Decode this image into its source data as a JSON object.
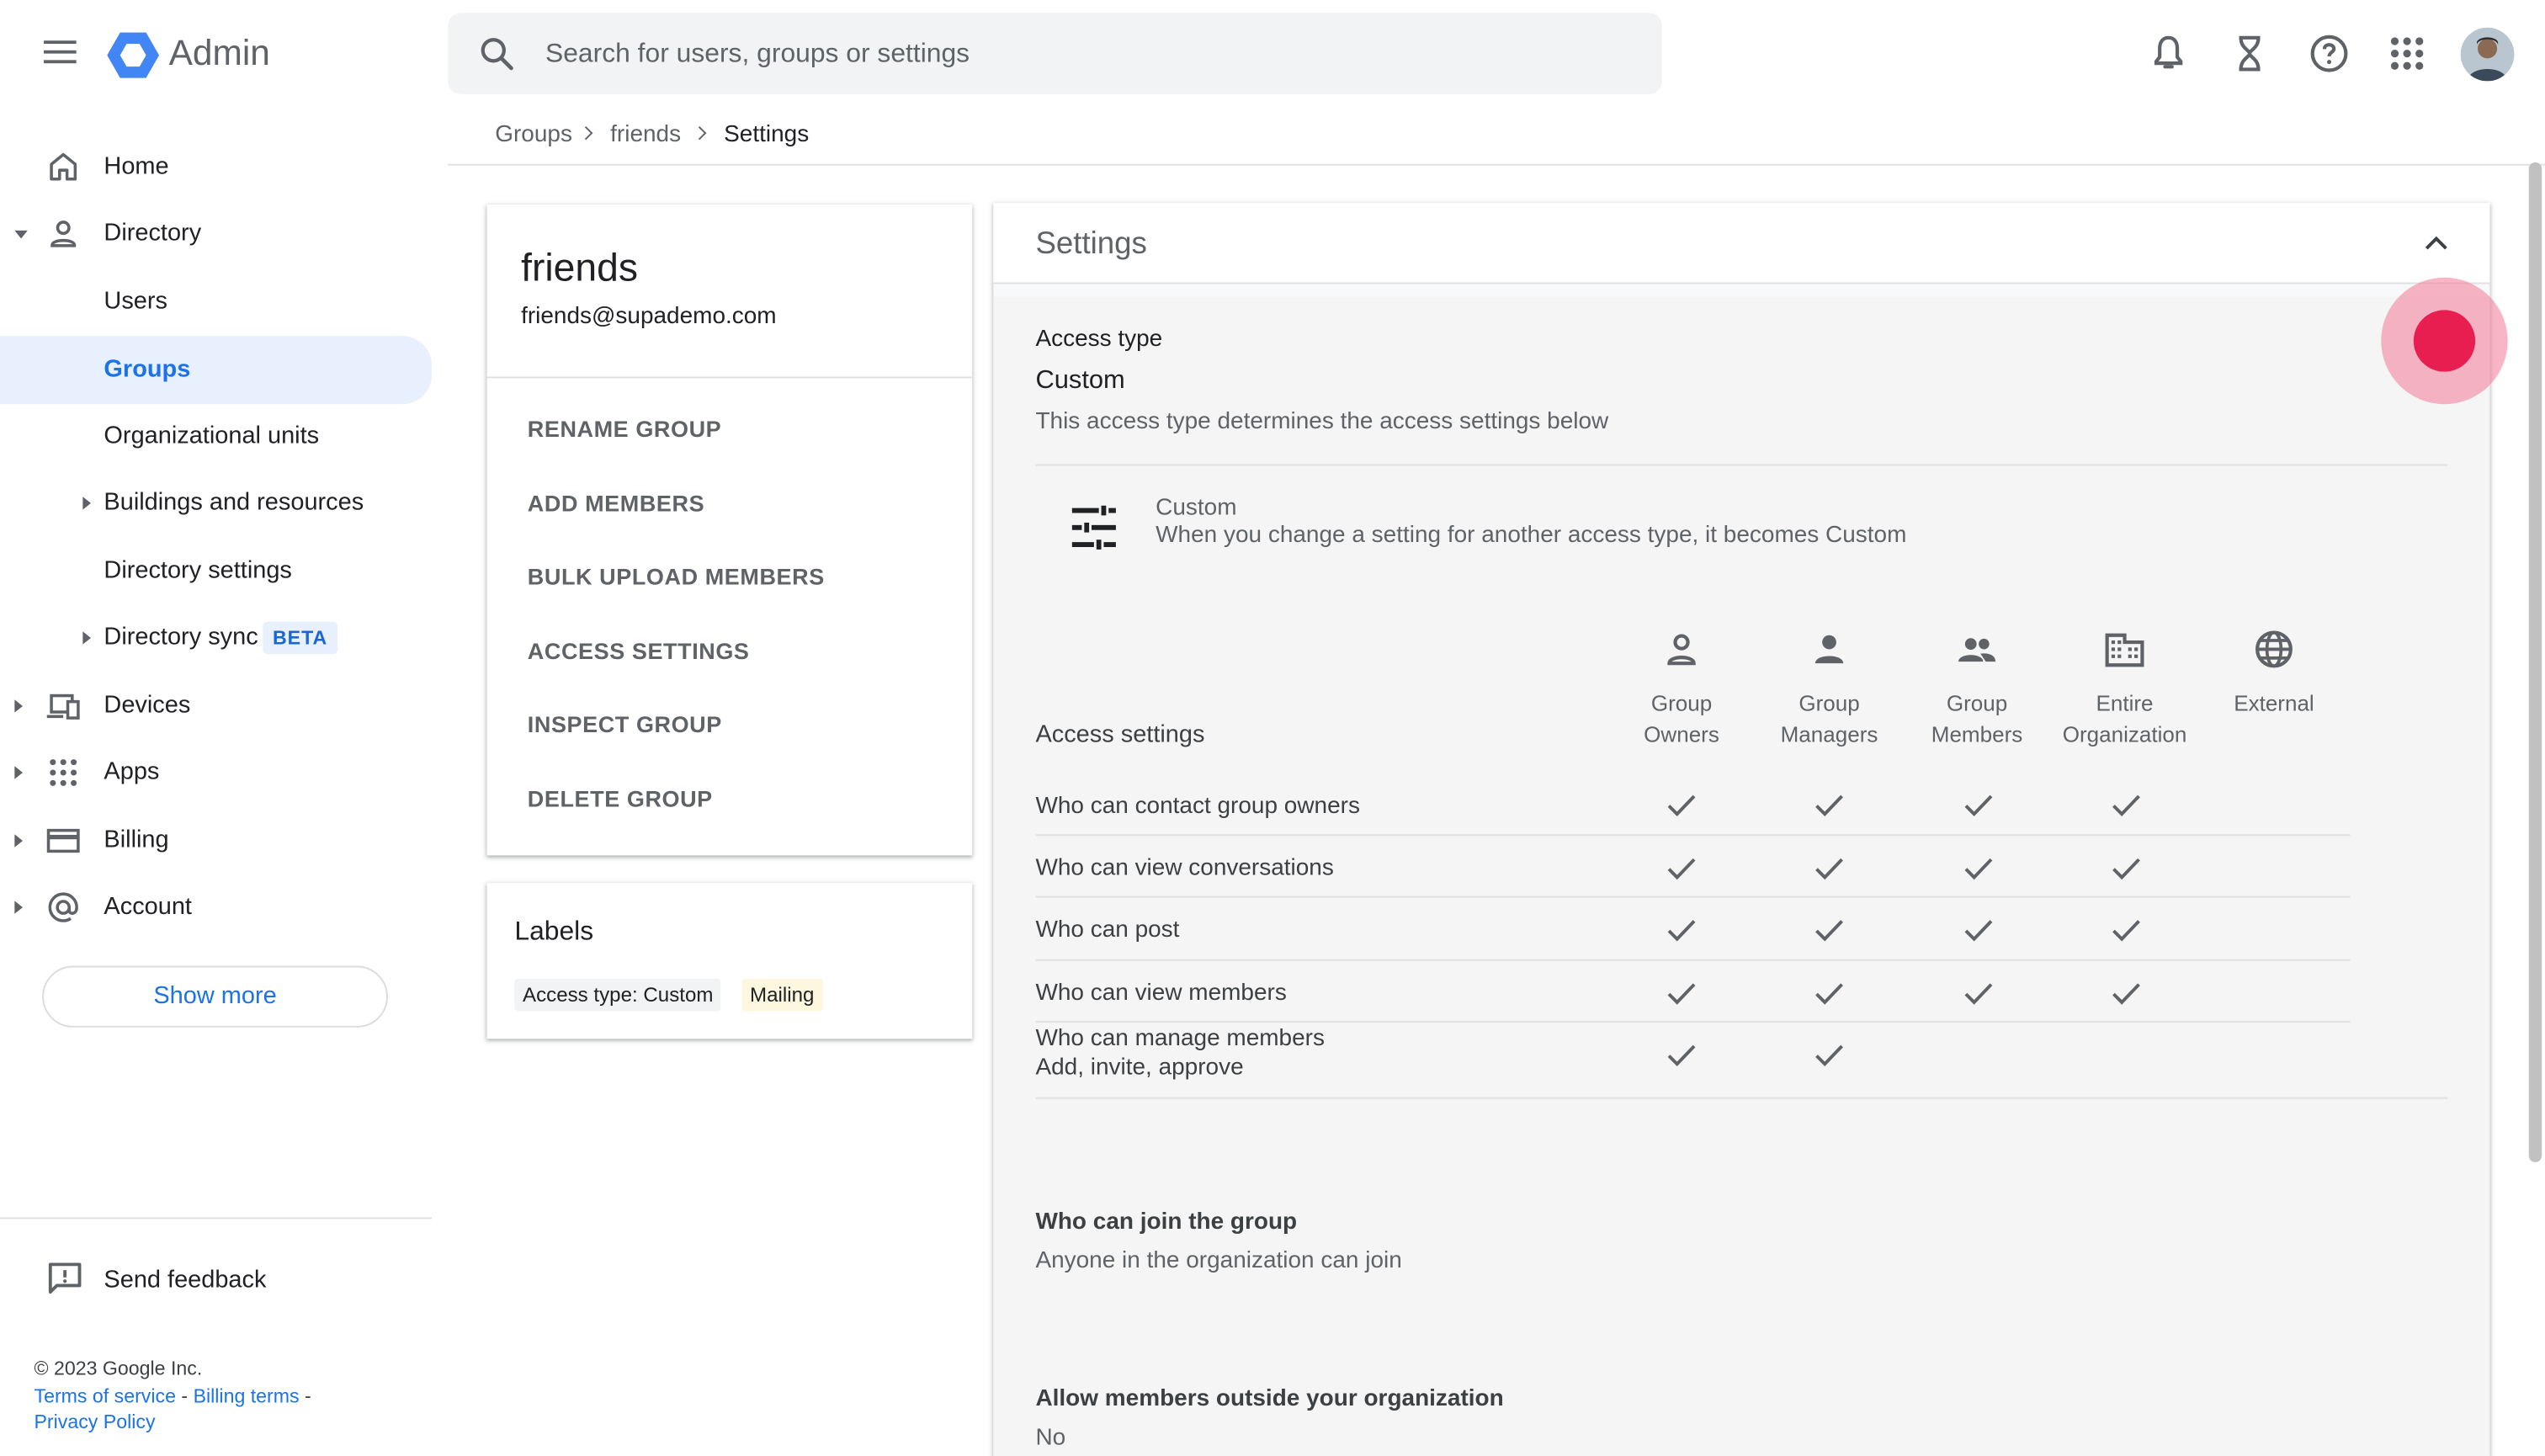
{
  "app": {
    "title": "Admin"
  },
  "search": {
    "placeholder": "Search for users, groups or settings",
    "value": ""
  },
  "header_icons": [
    "bell-icon",
    "hourglass-icon",
    "help-icon",
    "apps-grid-icon"
  ],
  "sidebar": {
    "items": [
      {
        "label": "Home",
        "icon": "home-icon"
      },
      {
        "label": "Directory",
        "icon": "person-icon",
        "expanded": true
      },
      {
        "label": "Users"
      },
      {
        "label": "Groups",
        "active": true
      },
      {
        "label": "Organizational units"
      },
      {
        "label": "Buildings and resources"
      },
      {
        "label": "Directory settings"
      },
      {
        "label": "Directory sync",
        "badge": "BETA"
      },
      {
        "label": "Devices",
        "icon": "devices-icon"
      },
      {
        "label": "Apps",
        "icon": "apps-icon"
      },
      {
        "label": "Billing",
        "icon": "credit-card-icon"
      },
      {
        "label": "Account",
        "icon": "at-sign-icon"
      }
    ],
    "show_more": "Show more",
    "send_feedback": "Send feedback",
    "footer": {
      "copyright": "© 2023 Google Inc.",
      "terms": "Terms of service",
      "billing_terms": "Billing terms",
      "privacy": "Privacy Policy",
      "sep": " - "
    }
  },
  "breadcrumb": [
    "Groups",
    "friends",
    "Settings"
  ],
  "group": {
    "name": "friends",
    "email": "friends@supademo.com",
    "actions": [
      "RENAME GROUP",
      "ADD MEMBERS",
      "BULK UPLOAD MEMBERS",
      "ACCESS SETTINGS",
      "INSPECT GROUP",
      "DELETE GROUP"
    ]
  },
  "labels": {
    "title": "Labels",
    "chips": [
      {
        "text": "Access type: Custom",
        "color": "#f1f3f4"
      },
      {
        "text": "Mailing",
        "color": "#fef7e0"
      }
    ]
  },
  "settings": {
    "title": "Settings",
    "access_type_label": "Access type",
    "access_type_value": "Custom",
    "access_type_desc": "This access type determines the access settings below",
    "custom_title": "Custom",
    "custom_desc": "When you change a setting for another access type, it becomes Custom",
    "access_settings_label": "Access settings",
    "columns": [
      {
        "line1": "Group",
        "line2": "Owners",
        "icon": "person-outline-icon"
      },
      {
        "line1": "Group",
        "line2": "Managers",
        "icon": "person-filled-icon"
      },
      {
        "line1": "Group",
        "line2": "Members",
        "icon": "people-icon"
      },
      {
        "line1": "Entire",
        "line2": "Organization",
        "icon": "building-icon"
      },
      {
        "line1": "External",
        "line2": "",
        "icon": "globe-icon"
      }
    ],
    "rows": [
      {
        "label": "Who can contact group owners",
        "sub": "",
        "checks": [
          true,
          true,
          true,
          true,
          false
        ]
      },
      {
        "label": "Who can view conversations",
        "sub": "",
        "checks": [
          true,
          true,
          true,
          true,
          false
        ]
      },
      {
        "label": "Who can post",
        "sub": "",
        "checks": [
          true,
          true,
          true,
          true,
          false
        ]
      },
      {
        "label": "Who can view members",
        "sub": "",
        "checks": [
          true,
          true,
          true,
          true,
          false
        ]
      },
      {
        "label": "Who can manage members",
        "sub": "Add, invite, approve",
        "checks": [
          true,
          true,
          false,
          false,
          false
        ]
      }
    ],
    "join_title": "Who can join the group",
    "join_value": "Anyone in the organization can join",
    "outside_title": "Allow members outside your organization",
    "outside_value": "No"
  },
  "colors": {
    "accent": "#1a73e8",
    "active_bg": "#e8f0fe",
    "cursor": "#e91e50"
  }
}
